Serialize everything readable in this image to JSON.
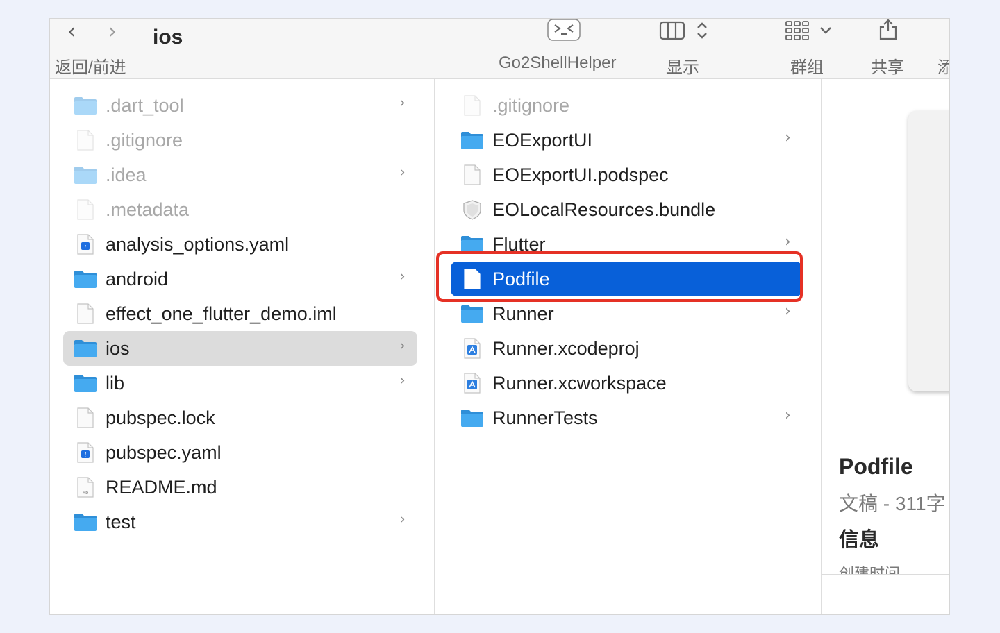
{
  "toolbar": {
    "back_glyph": "‹",
    "forward_glyph": "›",
    "title": "ios",
    "nav_label": "返回/前进",
    "shell_label": "Go2ShellHelper",
    "view_label": "显示",
    "group_label": "群组",
    "share_label": "共享",
    "add_label": "添"
  },
  "left_column": {
    "items": [
      {
        "name": ".dart_tool",
        "icon": "folder-icon",
        "hidden": true,
        "chevron": true
      },
      {
        "name": ".gitignore",
        "icon": "document-icon",
        "hidden": true,
        "chevron": false
      },
      {
        "name": ".idea",
        "icon": "folder-icon",
        "hidden": true,
        "chevron": true
      },
      {
        "name": ".metadata",
        "icon": "document-icon",
        "hidden": true,
        "chevron": false
      },
      {
        "name": "analysis_options.yaml",
        "icon": "yaml-file-icon",
        "hidden": false,
        "chevron": false
      },
      {
        "name": "android",
        "icon": "folder-icon",
        "hidden": false,
        "chevron": true
      },
      {
        "name": "effect_one_flutter_demo.iml",
        "icon": "document-icon",
        "hidden": false,
        "chevron": false
      },
      {
        "name": "ios",
        "icon": "folder-icon",
        "hidden": false,
        "chevron": true,
        "selected": true
      },
      {
        "name": "lib",
        "icon": "folder-icon",
        "hidden": false,
        "chevron": true
      },
      {
        "name": "pubspec.lock",
        "icon": "document-icon",
        "hidden": false,
        "chevron": false
      },
      {
        "name": "pubspec.yaml",
        "icon": "yaml-file-icon",
        "hidden": false,
        "chevron": false
      },
      {
        "name": "README.md",
        "icon": "markdown-file-icon",
        "hidden": false,
        "chevron": false
      },
      {
        "name": "test",
        "icon": "folder-icon",
        "hidden": false,
        "chevron": true
      }
    ]
  },
  "middle_column": {
    "items": [
      {
        "name": ".gitignore",
        "icon": "document-icon",
        "hidden": true,
        "chevron": false
      },
      {
        "name": "EOExportUI",
        "icon": "folder-icon",
        "hidden": false,
        "chevron": true
      },
      {
        "name": "EOExportUI.podspec",
        "icon": "document-icon",
        "hidden": false,
        "chevron": false
      },
      {
        "name": "EOLocalResources.bundle",
        "icon": "bundle-icon",
        "hidden": false,
        "chevron": false
      },
      {
        "name": "Flutter",
        "icon": "folder-icon",
        "hidden": false,
        "chevron": true
      },
      {
        "name": "Podfile",
        "icon": "document-icon",
        "hidden": false,
        "chevron": false,
        "selected": true
      },
      {
        "name": "Runner",
        "icon": "folder-icon",
        "hidden": false,
        "chevron": true
      },
      {
        "name": "Runner.xcodeproj",
        "icon": "xcode-project-icon",
        "hidden": false,
        "chevron": false
      },
      {
        "name": "Runner.xcworkspace",
        "icon": "xcode-workspace-icon",
        "hidden": false,
        "chevron": false
      },
      {
        "name": "RunnerTests",
        "icon": "folder-icon",
        "hidden": false,
        "chevron": true
      }
    ]
  },
  "preview": {
    "file_name": "Podfile",
    "kind": "文稿 - 311字",
    "info_heading": "信息",
    "created_label": "创建时间"
  },
  "colors": {
    "selection_blue": "#0860d9",
    "selection_gray": "#dcdcdc",
    "highlight_red": "#e53125",
    "folder_blue": "#3ea4ee"
  }
}
